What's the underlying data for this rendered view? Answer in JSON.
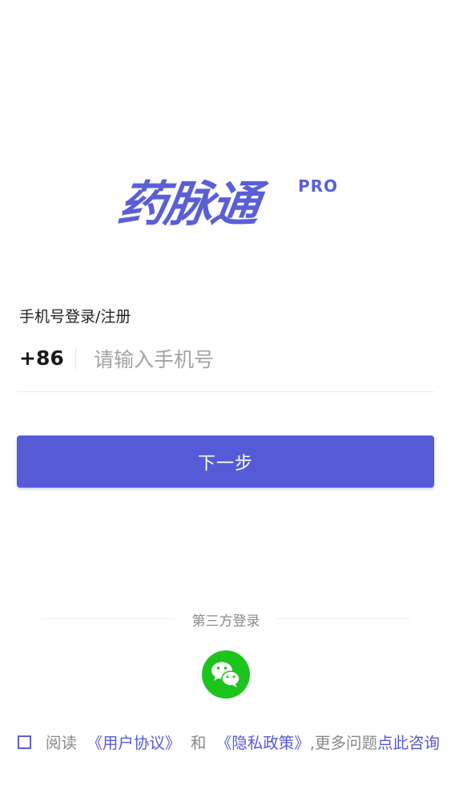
{
  "logo": {
    "name": "药脉通",
    "badge": "PRO"
  },
  "login": {
    "label": "手机号登录/注册",
    "country_code": "+86",
    "phone_placeholder": "请输入手机号",
    "phone_value": "",
    "next_button": "下一步"
  },
  "third_party": {
    "label": "第三方登录",
    "wechat_icon": "wechat-icon"
  },
  "agreement": {
    "read": "阅读",
    "user_agreement": "《用户协议》",
    "and": "和",
    "privacy_policy": "《隐私政策》",
    "more": ",更多问题",
    "consult": "点此咨询",
    "checked": false
  },
  "colors": {
    "accent": "#555ad6",
    "wechat": "#1ec41e"
  }
}
